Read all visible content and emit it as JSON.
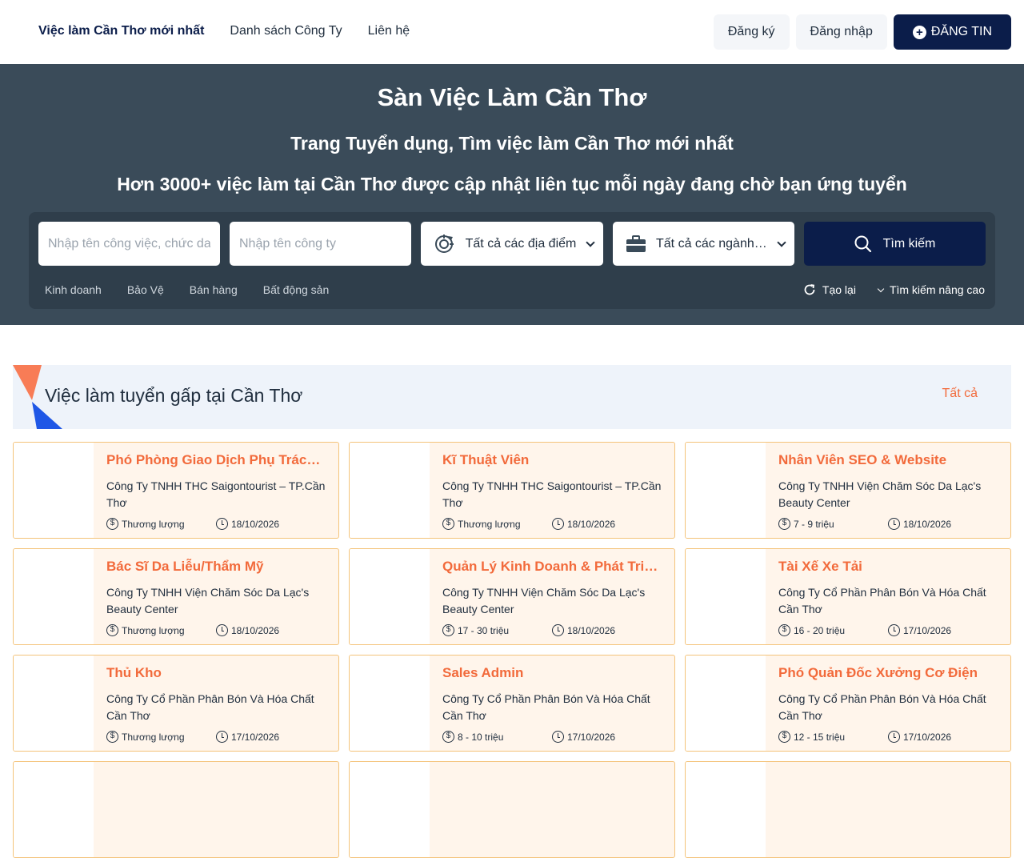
{
  "nav": {
    "items": [
      "Việc làm Cần Thơ mới nhất",
      "Danh sách Công Ty",
      "Liên hệ"
    ],
    "register": "Đăng ký",
    "login": "Đăng nhập",
    "post": "ĐĂNG TIN"
  },
  "hero": {
    "title": "Sàn Việc Làm Cần Thơ",
    "subtitle": "Trang Tuyển dụng, Tìm việc làm Cần Thơ mới nhất",
    "tagline": "Hơn 3000+ việc làm tại Cần Thơ được cập nhật liên tục mỗi ngày đang chờ bạn ứng tuyển"
  },
  "search": {
    "job_placeholder": "Nhập tên công việc, chức danh",
    "company_placeholder": "Nhập tên công ty",
    "location": "Tất cả các địa điểm",
    "industry": "Tất cả các ngành nghề",
    "button": "Tìm kiếm",
    "tags": [
      "Kinh doanh",
      "Bảo Vệ",
      "Bán hàng",
      "Bất động sản"
    ],
    "reset": "Tạo lại",
    "advanced": "Tìm kiếm nâng cao"
  },
  "section": {
    "title": "Việc làm tuyển gấp tại Cần Thơ",
    "see_all": "Tất cả"
  },
  "colors": {
    "primary": "#0b1d4a",
    "accent": "#f26a3b",
    "hero_bg": "#3a4b59",
    "card_bg": "#fff5eb",
    "card_border": "#f4c37a"
  },
  "jobs": [
    {
      "title": "Phó Phòng Giao Dịch Phụ Trách Kinh Doanh",
      "company": "Công Ty TNHH THC Saigontourist – TP.Cần Thơ",
      "salary": "Thương lượng",
      "date": "18/10/2026"
    },
    {
      "title": "Kĩ Thuật Viên",
      "company": "Công Ty TNHH THC Saigontourist – TP.Cần Thơ",
      "salary": "Thương lượng",
      "date": "18/10/2026"
    },
    {
      "title": "Nhân Viên SEO & Website",
      "company": "Công Ty TNHH Viện Chăm Sóc Da Lạc's Beauty Center",
      "salary": "7 - 9 triệu",
      "date": "18/10/2026"
    },
    {
      "title": "Bác Sĩ Da Liễu/Thẩm Mỹ",
      "company": "Công Ty TNHH Viện Chăm Sóc Da Lạc's Beauty Center",
      "salary": "Thương lượng",
      "date": "18/10/2026"
    },
    {
      "title": "Quản Lý Kinh Doanh & Phát Triển Thị Trường",
      "company": "Công Ty TNHH Viện Chăm Sóc Da Lạc's Beauty Center",
      "salary": "17 - 30 triệu",
      "date": "18/10/2026"
    },
    {
      "title": "Tài Xế Xe Tải",
      "company": "Công Ty Cổ Phần Phân Bón Và Hóa Chất Cần Thơ",
      "salary": "16 - 20 triệu",
      "date": "17/10/2026"
    },
    {
      "title": "Thủ Kho",
      "company": "Công Ty Cổ Phần Phân Bón Và Hóa Chất Cần Thơ",
      "salary": "Thương lượng",
      "date": "17/10/2026"
    },
    {
      "title": "Sales Admin",
      "company": "Công Ty Cổ Phần Phân Bón Và Hóa Chất Cần Thơ",
      "salary": "8 - 10 triệu",
      "date": "17/10/2026"
    },
    {
      "title": "Phó Quản Đốc Xưởng Cơ Điện",
      "company": "Công Ty Cổ Phần Phân Bón Và Hóa Chất Cần Thơ",
      "salary": "12 - 15 triệu",
      "date": "17/10/2026"
    }
  ]
}
